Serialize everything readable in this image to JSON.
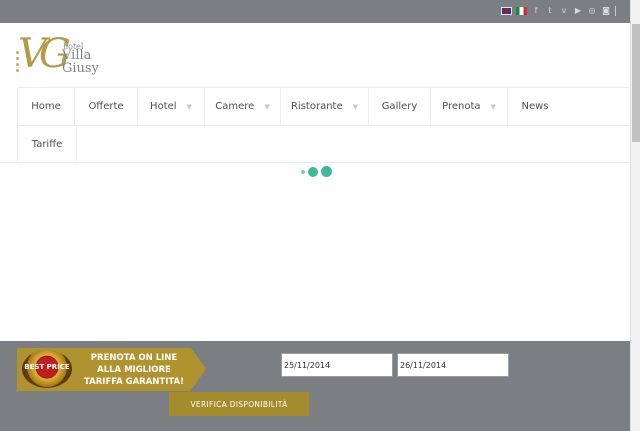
{
  "topbar": {
    "social": [
      {
        "name": "flag-uk-icon"
      },
      {
        "name": "flag-it-icon"
      },
      {
        "name": "facebook-icon",
        "glyph": "f"
      },
      {
        "name": "twitter-icon",
        "glyph": "t"
      },
      {
        "name": "vimeo-icon",
        "glyph": "v"
      },
      {
        "name": "youtube-icon",
        "glyph": "▶"
      },
      {
        "name": "tripadvisor-icon",
        "glyph": "◎"
      },
      {
        "name": "instagram-icon",
        "glyph": "◙"
      }
    ]
  },
  "logo": {
    "monogram": "VG",
    "small": "hotel",
    "line1": "Villa",
    "line2": "Giusy"
  },
  "nav": {
    "row1": [
      {
        "label": "Home",
        "dropdown": false
      },
      {
        "label": "Offerte",
        "dropdown": false
      },
      {
        "label": "Hotel",
        "dropdown": true
      },
      {
        "label": "Camere",
        "dropdown": true
      },
      {
        "label": "Ristorante",
        "dropdown": true
      },
      {
        "label": "Gallery",
        "dropdown": false
      },
      {
        "label": "Prenota",
        "dropdown": true
      },
      {
        "label": "News",
        "dropdown": false
      }
    ],
    "row2": [
      {
        "label": "Tariffe",
        "dropdown": false
      }
    ]
  },
  "booking": {
    "badge_text": "BEST PRICE",
    "promo_line1": "PRENOTA ON LINE",
    "promo_line2": "ALLA MIGLIORE",
    "promo_line3": "TARIFFA GARANTITA!",
    "checkin": "25/11/2014",
    "checkout": "26/11/2014",
    "verify_label": "VERIFICA DISPONIBILITÀ"
  },
  "colors": {
    "bar_gray": "#7b7e83",
    "gold": "#b0932f",
    "loader_green": "#3fb99a"
  }
}
